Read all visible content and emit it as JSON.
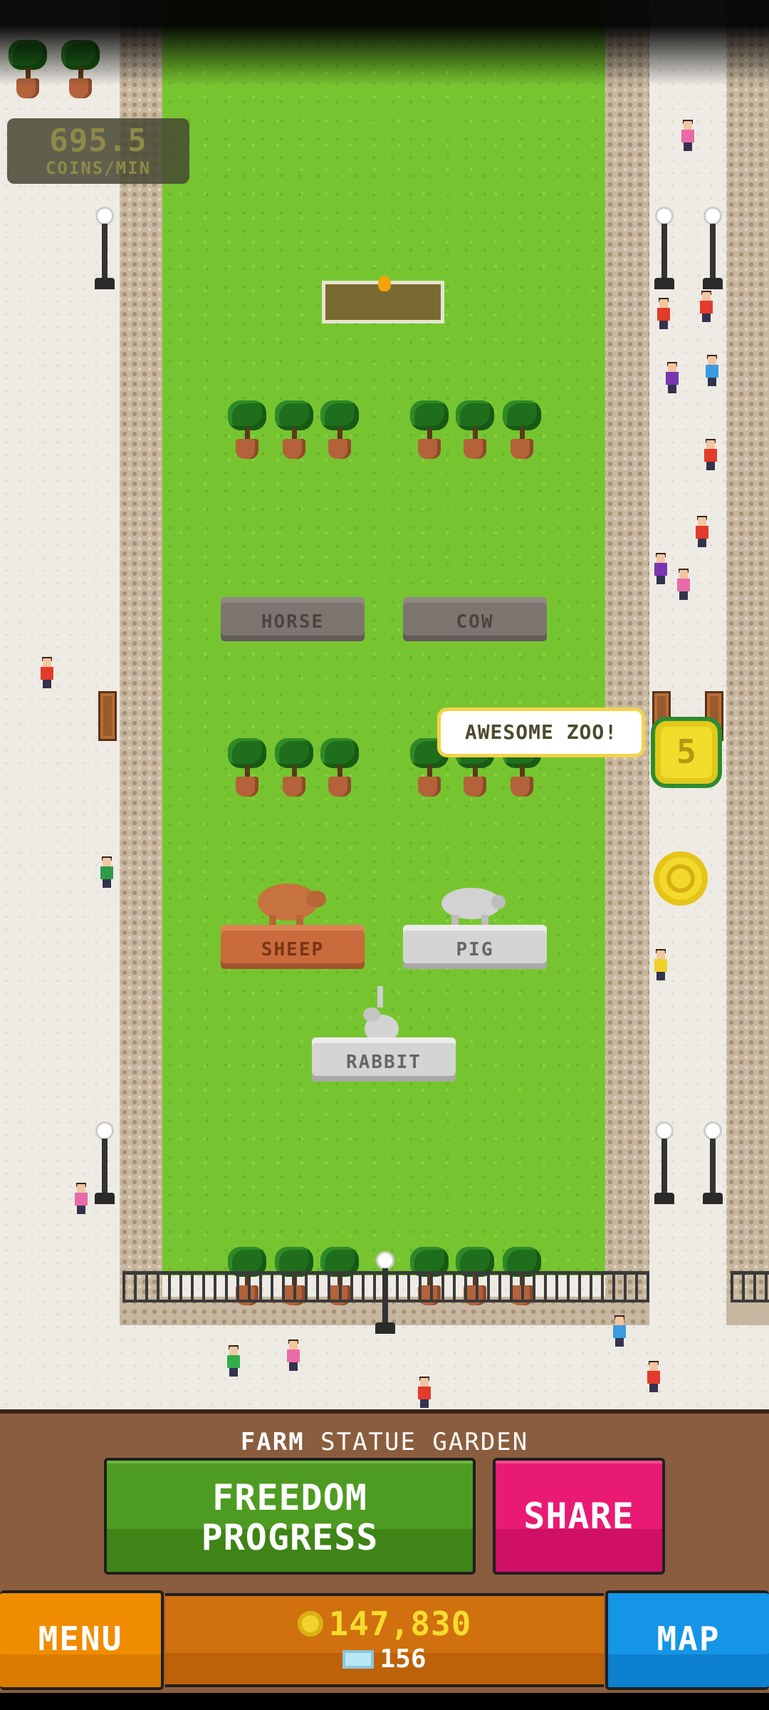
{
  "hud": {
    "coins_per_min_value": "695.5",
    "coins_per_min_label": "COINS/MIN"
  },
  "exhibits": {
    "plinth_1": "HORSE",
    "plinth_2": "COW",
    "plinth_3": "SHEEP",
    "plinth_4": "PIG",
    "plinth_5": "RABBIT"
  },
  "speech_bubble": "AWESOME ZOO!",
  "coin_drop_value": "5",
  "location": {
    "category": "FARM",
    "name": "STATUE GARDEN"
  },
  "buttons": {
    "freedom_line1": "FREEDOM",
    "freedom_line2": "PROGRESS",
    "share": "SHARE",
    "menu": "MENU",
    "map": "MAP"
  },
  "currency": {
    "coins": "147,830",
    "gems": "156"
  },
  "colors": {
    "grass": "#76c530",
    "freedom_button": "#4e9b22",
    "share_button": "#e81a74",
    "menu_button": "#f08c00",
    "map_button": "#1595e6",
    "currency_bar": "#d0700e",
    "coin_gold": "#f7dc2f"
  },
  "icons": {
    "coin": "coin-icon",
    "gem": "gem-icon"
  }
}
